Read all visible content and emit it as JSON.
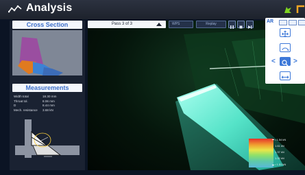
{
  "app": {
    "title": "Analysis",
    "title_icon": "analysis-chart-icon",
    "toolbar_icons": [
      "bird-flag-icon",
      "panel-corner-icon"
    ]
  },
  "left_panel": {
    "cross_section_title": "Cross Section",
    "measurements_title": "Measurements",
    "measurements": [
      {
        "label": "Width total",
        "value": "18.30 mm"
      },
      {
        "label": "Throat tol.",
        "value": "8.06 mm"
      },
      {
        "label": "D",
        "value": "8.44 mm"
      },
      {
        "label": "Mech. resistance",
        "value": "3.68 kN"
      }
    ]
  },
  "viewport_toolbar": {
    "pass_selector": "Pass 3 of 3",
    "wps_button": "WPS",
    "replay_label": "Replay",
    "media_buttons": [
      "pause-icon",
      "stop-icon",
      "next-icon"
    ]
  },
  "tool_panel": {
    "ar_label": "AR",
    "tools": [
      "move-icon",
      "rotate-icon",
      "zoom-icon",
      "fit-icon"
    ],
    "nav": [
      "chevron-left-icon",
      "chevron-right-icon"
    ]
  },
  "legend": {
    "labels": [
      "• 1.54 kN",
      "1.61 kN",
      "1.37 kN",
      "1.32 kN",
      "• 1.51 kN"
    ],
    "colors": [
      "#e6332a",
      "#f0a030",
      "#e8e64a",
      "#8ee06a",
      "#5fcaa8",
      "#59b8d8"
    ]
  },
  "colors": {
    "accent": "#3d78d8",
    "panel_bg": "#1a2232",
    "title_bg": "#2c3240",
    "weld_cyan": "#6ef0d8"
  }
}
